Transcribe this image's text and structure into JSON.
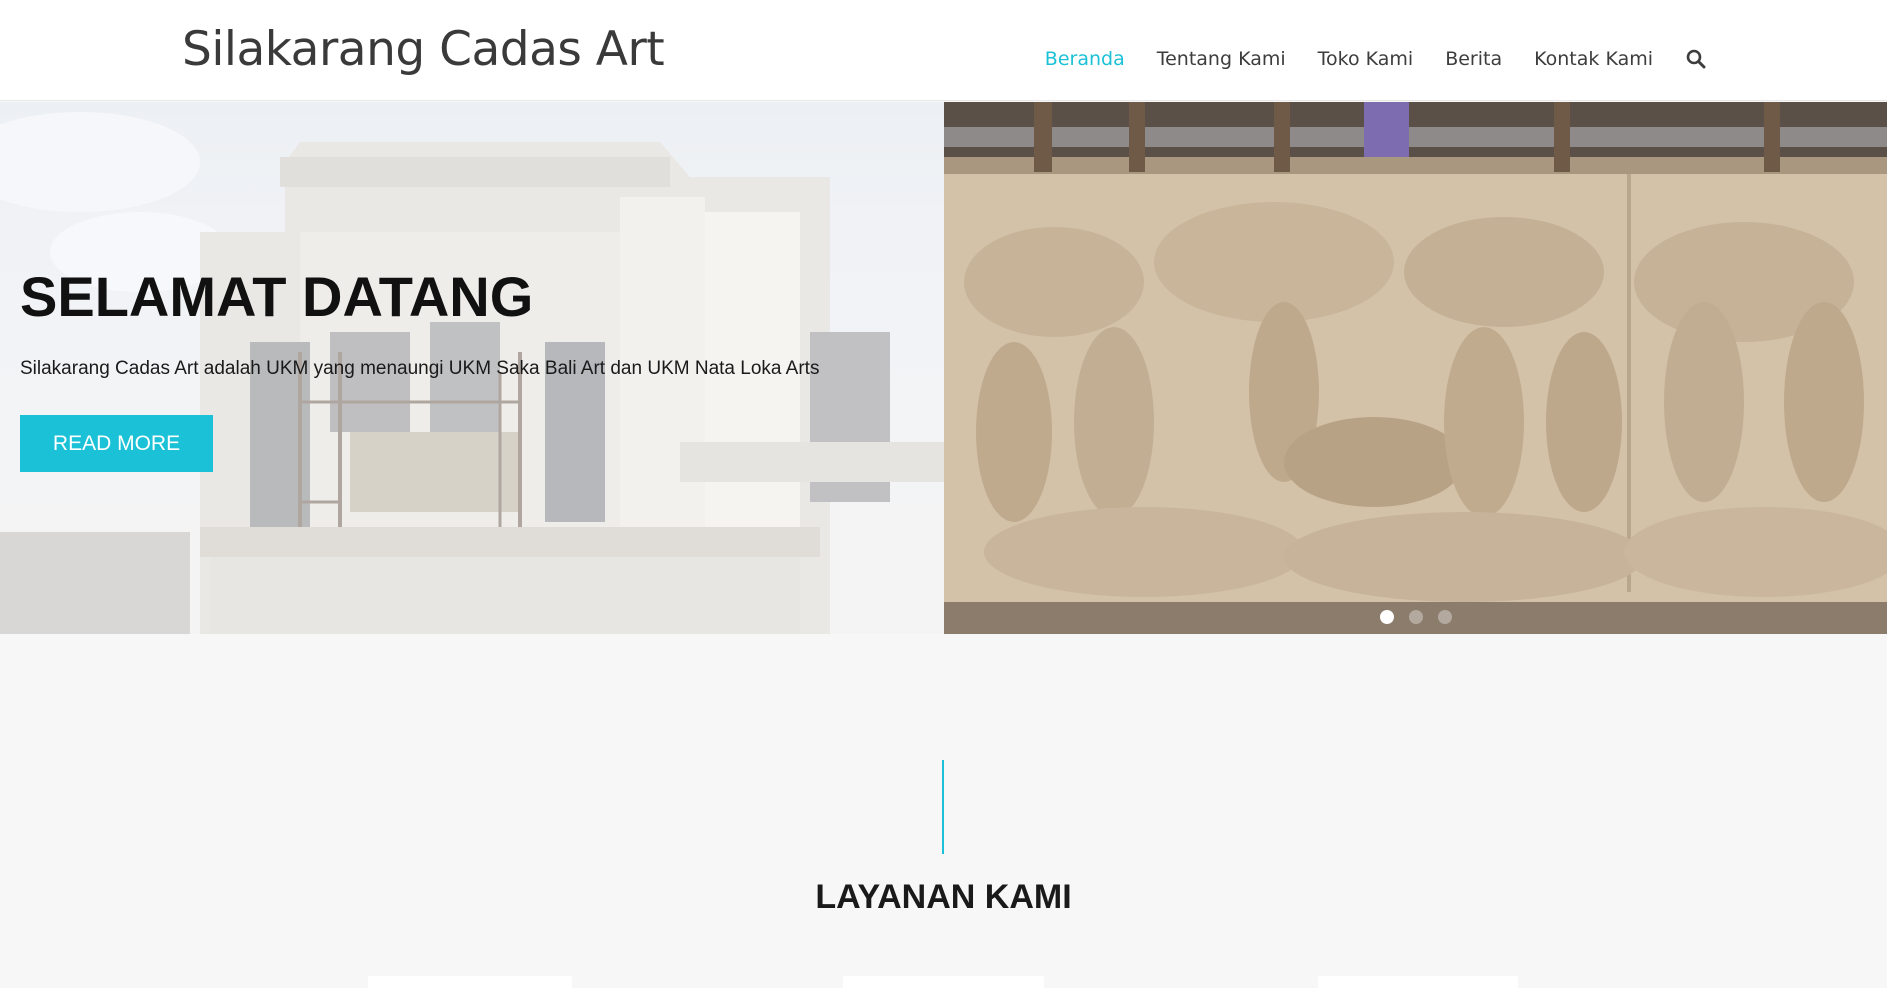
{
  "site": {
    "title": "Silakarang Cadas Art"
  },
  "nav": {
    "items": [
      {
        "label": "Beranda",
        "active": true
      },
      {
        "label": "Tentang Kami",
        "active": false
      },
      {
        "label": "Toko Kami",
        "active": false
      },
      {
        "label": "Berita",
        "active": false
      },
      {
        "label": "Kontak Kami",
        "active": false
      }
    ],
    "search_icon": "search-icon"
  },
  "hero": {
    "title": "SELAMAT DATANG",
    "text": "Silakarang Cadas Art adalah UKM yang menaungi UKM Saka Bali Art dan UKM Nata Loka Arts",
    "button_label": "READ MORE",
    "slides_total": 3,
    "slide_active": 1
  },
  "services": {
    "title": "LAYANAN KAMI"
  },
  "colors": {
    "accent": "#1bc1d6",
    "background": "#f7f7f7",
    "text": "#1a1a1a"
  }
}
